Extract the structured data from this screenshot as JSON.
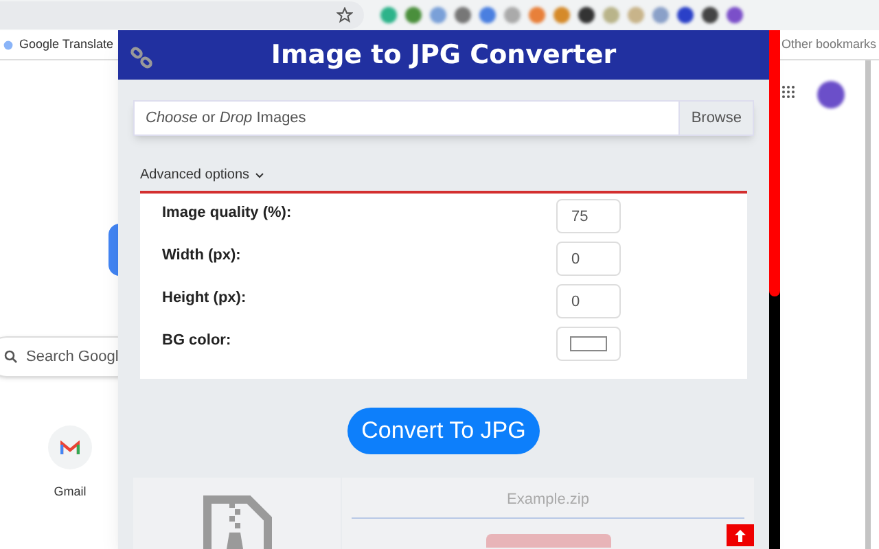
{
  "browser": {
    "bookmarks": [
      {
        "label": "Google Translate"
      }
    ],
    "other_bookmarks": "Other bookmarks",
    "search_placeholder": "Search Googl",
    "shortcuts": [
      {
        "label": "Gmail"
      }
    ]
  },
  "popup": {
    "title": "Image to JPG Converter",
    "file_input": {
      "placeholder": "*Choose* or *Drop* Images",
      "button": "Browse"
    },
    "advanced": {
      "label": "Advanced options",
      "expanded": true,
      "options": [
        {
          "kind": "number",
          "label": "Image quality (%):",
          "value": "75"
        },
        {
          "kind": "number",
          "label": "Width (px):",
          "value": "0"
        },
        {
          "kind": "number",
          "label": "Height (px):",
          "value": "0"
        },
        {
          "kind": "color",
          "label": "BG color:"
        }
      ]
    },
    "convert_button": "Convert To JPG",
    "result": {
      "filename": "Example.zip"
    }
  }
}
